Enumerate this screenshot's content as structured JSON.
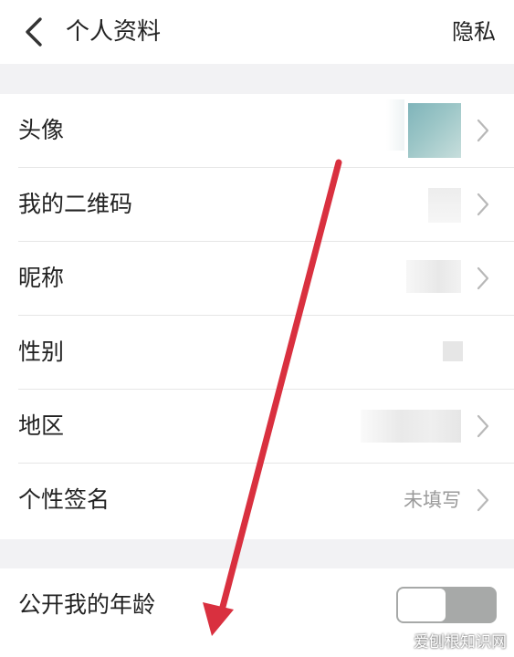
{
  "header": {
    "title": "个人资料",
    "privacy_label": "隐私"
  },
  "rows": [
    {
      "label": "头像",
      "value": ""
    },
    {
      "label": "我的二维码",
      "value": ""
    },
    {
      "label": "昵称",
      "value": ""
    },
    {
      "label": "性别",
      "value": ""
    },
    {
      "label": "地区",
      "value": ""
    },
    {
      "label": "个性签名",
      "value": "未填写"
    }
  ],
  "age_toggle": {
    "label": "公开我的年龄",
    "on": false
  },
  "watermark": "爱刨根知识网",
  "icons": {
    "back": "chevron-left-icon",
    "row": "chevron-right-icon"
  },
  "colors": {
    "background_gap": "#f2f2f4",
    "toggle_track": "#a7a9a8",
    "annotation_arrow": "#d9303f",
    "muted_text": "#9a9a9a"
  }
}
